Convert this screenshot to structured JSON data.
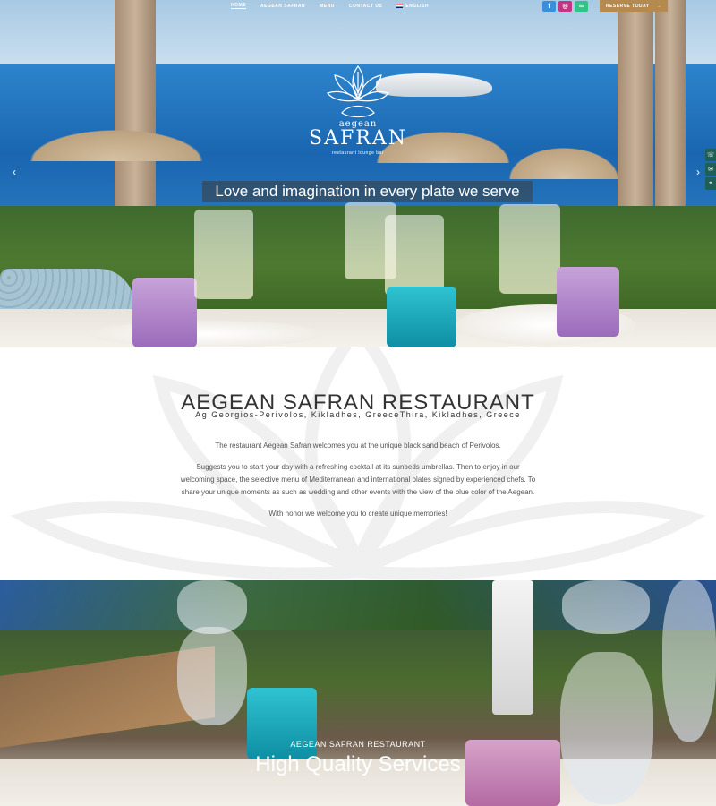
{
  "nav": {
    "links": [
      {
        "label": "HOME",
        "active": true
      },
      {
        "label": "AEGEAN SAFRAN",
        "active": false
      },
      {
        "label": "MENU",
        "active": false
      },
      {
        "label": "CONTACT US",
        "active": false
      }
    ],
    "language": "ENGLISH",
    "socials": [
      {
        "icon": "facebook-icon",
        "glyph": "f",
        "color": "#3b8ed8"
      },
      {
        "icon": "instagram-icon",
        "glyph": "◎",
        "color": "#c13584"
      },
      {
        "icon": "tripadvisor-icon",
        "glyph": "∞",
        "color": "#34c18a"
      }
    ],
    "reserve_label": "RESERVE TODAY",
    "reserve_color": "#b48a4f"
  },
  "hero": {
    "logo_aegean": "aegean",
    "logo_safran": "SAFRAN",
    "logo_sub": "restaurant lounge bar",
    "tagline": "Love and imagination in every plate we serve",
    "prev_icon": "chevron-left-icon",
    "next_icon": "chevron-right-icon",
    "side_tabs": [
      "phone-icon",
      "envelope-icon",
      "map-icon"
    ]
  },
  "about": {
    "title": "AEGEAN SAFRAN RESTAURANT",
    "subtitle": "Ag.Georgios-Perivolos, Kikladhes, GreeceThira, Kikladhes, Greece",
    "paragraphs": [
      "The restaurant Aegean Safran welcomes you at the unique black sand beach of Perivolos.",
      "Suggests you to start your day with a refreshing cocktail at its sunbeds umbrellas. Then to enjoy in our welcoming space, the selective menu of Mediterranean and international plates signed by experienced chefs. To share your unique moments as such as wedding and other events with the view of the blue color of the Aegean.",
      "With honor we welcome you to create unique memories!"
    ]
  },
  "services": {
    "kicker": "AEGEAN SAFRAN RESTAURANT",
    "title": "High Quality Services"
  }
}
